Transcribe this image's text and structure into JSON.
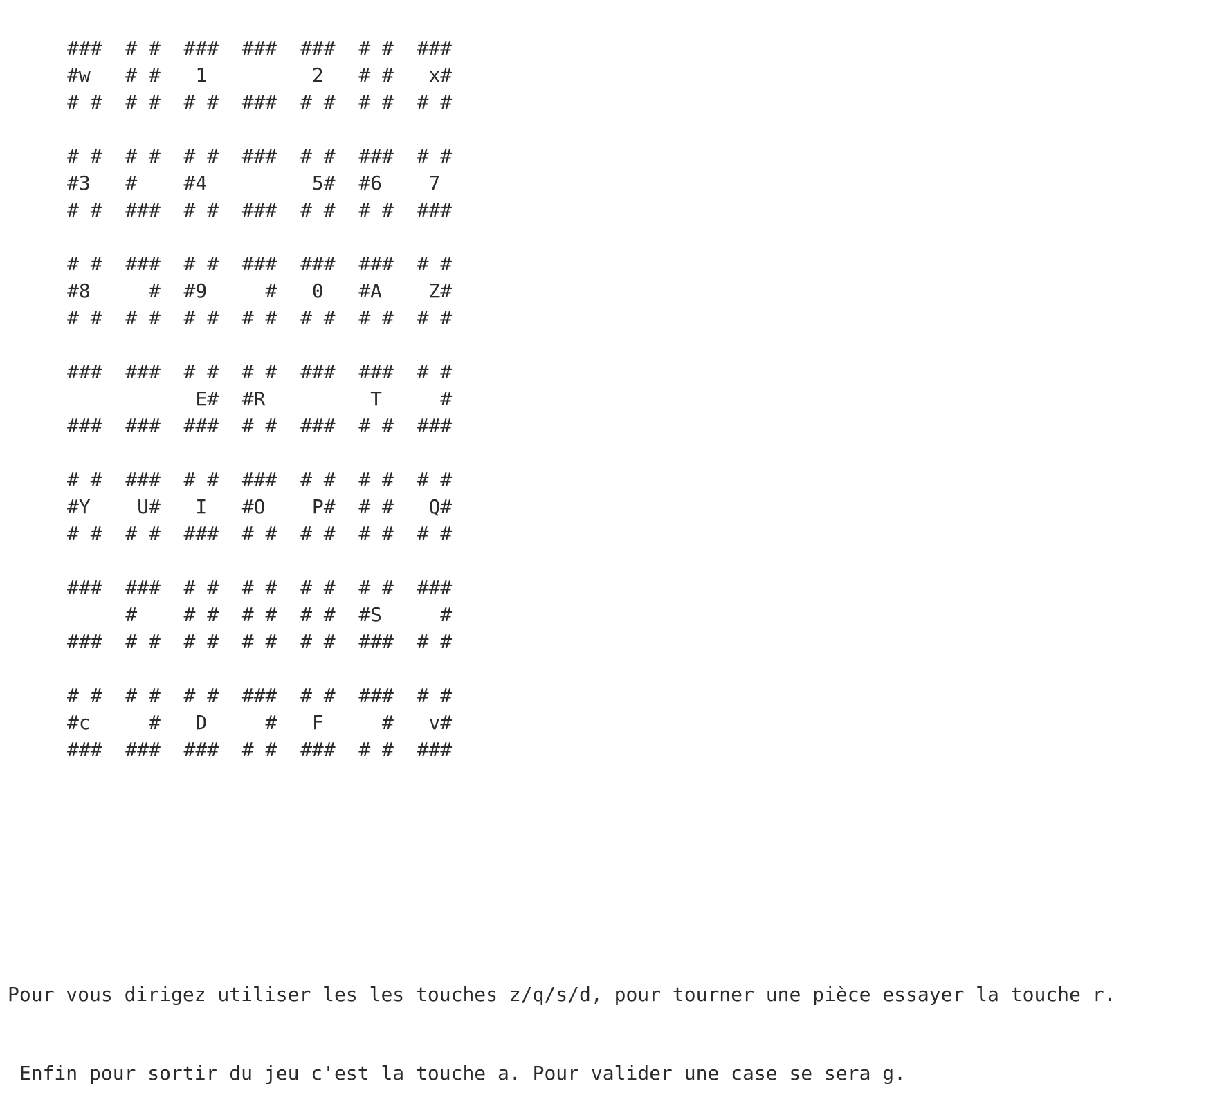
{
  "board": {
    "tiles": [
      [
        [
          "###",
          "#w ",
          "# #"
        ],
        [
          "# #",
          "# #",
          "# #"
        ],
        [
          "###",
          " 1 ",
          "# #"
        ],
        [
          "###",
          "   ",
          "###"
        ],
        [
          "###",
          " 2 ",
          "# #"
        ],
        [
          "# #",
          "# #",
          "# #"
        ],
        [
          "###",
          " x#",
          "# #"
        ]
      ],
      [
        [
          "# #",
          "#3 ",
          "# #"
        ],
        [
          "# #",
          "#  ",
          "###"
        ],
        [
          "# #",
          "#4 ",
          "# #"
        ],
        [
          "###",
          "   ",
          "###"
        ],
        [
          "# #",
          " 5#",
          "# #"
        ],
        [
          "###",
          "#6 ",
          "# #"
        ],
        [
          "# #",
          " 7 ",
          "###"
        ]
      ],
      [
        [
          "# #",
          "#8 ",
          "# #"
        ],
        [
          "###",
          "  #",
          "# #"
        ],
        [
          "# #",
          "#9 ",
          "# #"
        ],
        [
          "###",
          "  #",
          "# #"
        ],
        [
          "###",
          " 0 ",
          "# #"
        ],
        [
          "###",
          "#A ",
          "# #"
        ],
        [
          "# #",
          " Z#",
          "# #"
        ]
      ],
      [
        [
          "###",
          "   ",
          "###"
        ],
        [
          "###",
          "   ",
          "###"
        ],
        [
          "# #",
          " E#",
          "###"
        ],
        [
          "# #",
          "#R ",
          "# #"
        ],
        [
          "###",
          "   ",
          "###"
        ],
        [
          "###",
          " T ",
          "# #"
        ],
        [
          "# #",
          "  #",
          "###"
        ]
      ],
      [
        [
          "# #",
          "#Y ",
          "# #"
        ],
        [
          "###",
          " U#",
          "# #"
        ],
        [
          "# #",
          " I ",
          "###"
        ],
        [
          "###",
          "#O ",
          "# #"
        ],
        [
          "# #",
          " P#",
          "# #"
        ],
        [
          "# #",
          "# #",
          "# #"
        ],
        [
          "# #",
          " Q#",
          "# #"
        ]
      ],
      [
        [
          "###",
          "   ",
          "###"
        ],
        [
          "###",
          "#  ",
          "# #"
        ],
        [
          "# #",
          "# #",
          "# #"
        ],
        [
          "# #",
          "# #",
          "# #"
        ],
        [
          "# #",
          "# #",
          "# #"
        ],
        [
          "# #",
          "#S ",
          "###"
        ],
        [
          "###",
          "  #",
          "# #"
        ]
      ],
      [
        [
          "# #",
          "#c ",
          "###"
        ],
        [
          "# #",
          "  #",
          "###"
        ],
        [
          "# #",
          " D ",
          "###"
        ],
        [
          "###",
          "  #",
          "# #"
        ],
        [
          "# #",
          " F ",
          "###"
        ],
        [
          "###",
          "  #",
          "# #"
        ],
        [
          "# #",
          " v#",
          "###"
        ]
      ]
    ]
  },
  "instructions": {
    "line1": "Pour vous dirigez utiliser les les touches z/q/s/d, pour tourner une pièce essayer la touche r.",
    "line2": " Enfin pour sortir du jeu c'est la touche a. Pour valider une case se sera g."
  }
}
